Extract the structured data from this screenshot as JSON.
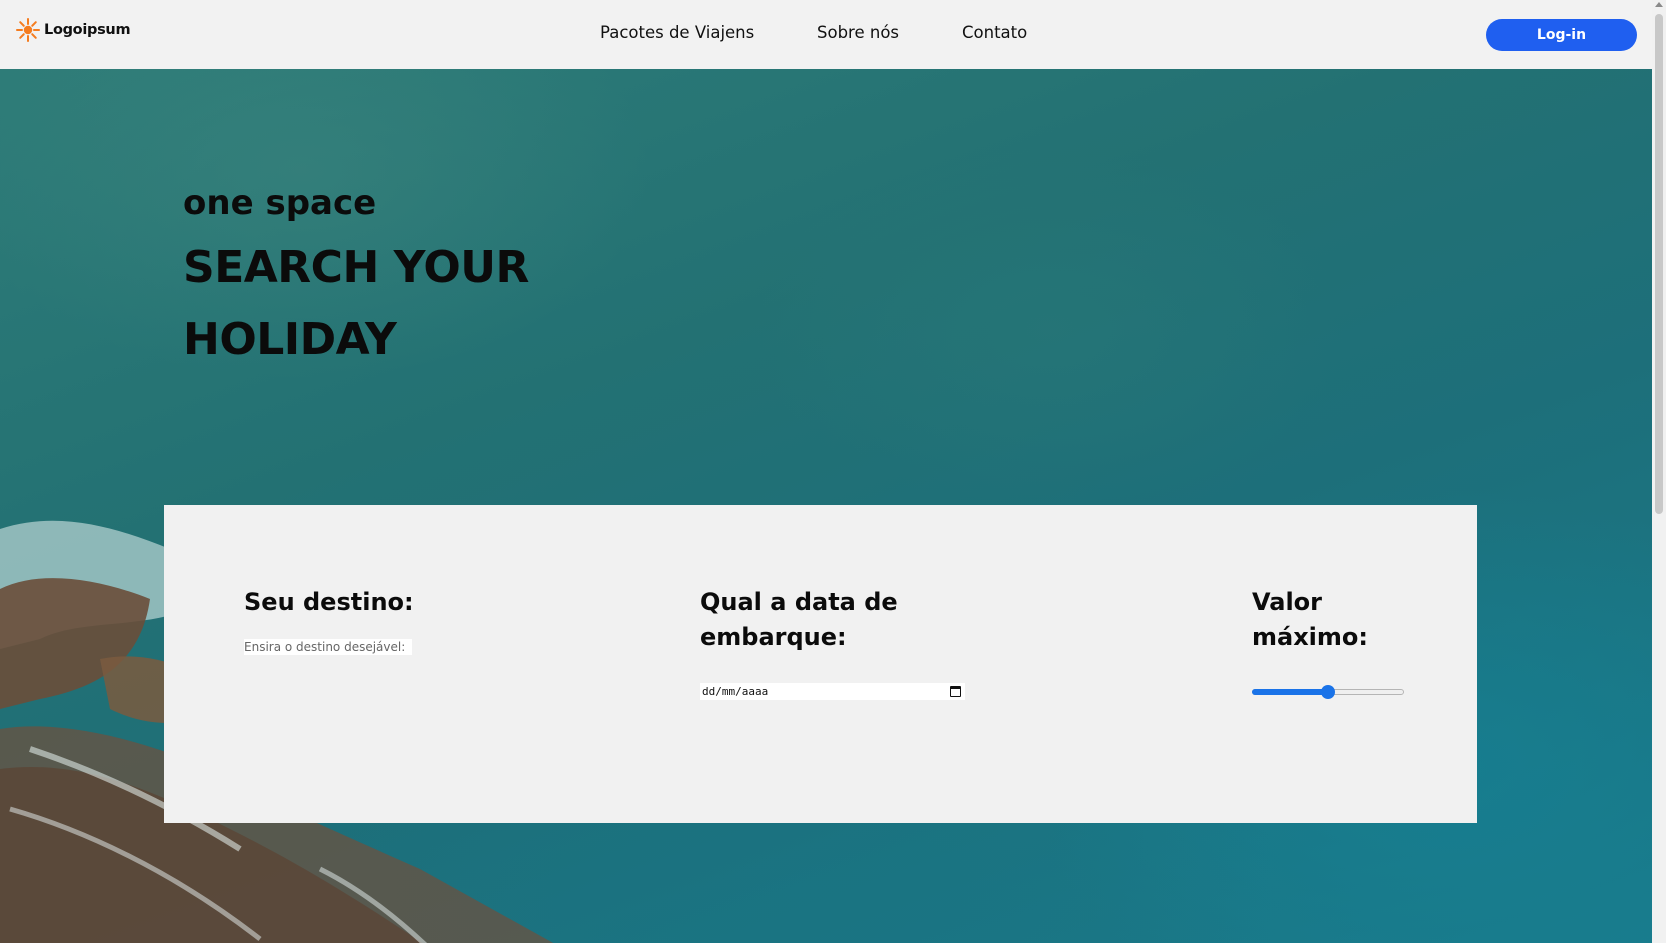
{
  "brand": {
    "name": "Logoipsum",
    "accent_color": "#f57c1f",
    "icon": "sunburst-logo-icon"
  },
  "nav": {
    "links": [
      "Pacotes de Viajens",
      "Sobre nós",
      "Contato"
    ],
    "login_label": "Log-in",
    "login_color": "#1f5ff0"
  },
  "hero": {
    "subtitle": "one space",
    "title": "SEARCH YOUR HOLIDAY"
  },
  "search": {
    "destination": {
      "label": "Seu destino:",
      "placeholder": "Ensira o destino desejável:"
    },
    "date": {
      "label": "Qual a data de embarque:",
      "placeholder": "dd/mm/aaaa",
      "icon": "calendar-icon"
    },
    "max_value": {
      "label": "Valor máximo:",
      "slider_fraction": 0.5,
      "slider_color": "#1a73e8"
    }
  }
}
